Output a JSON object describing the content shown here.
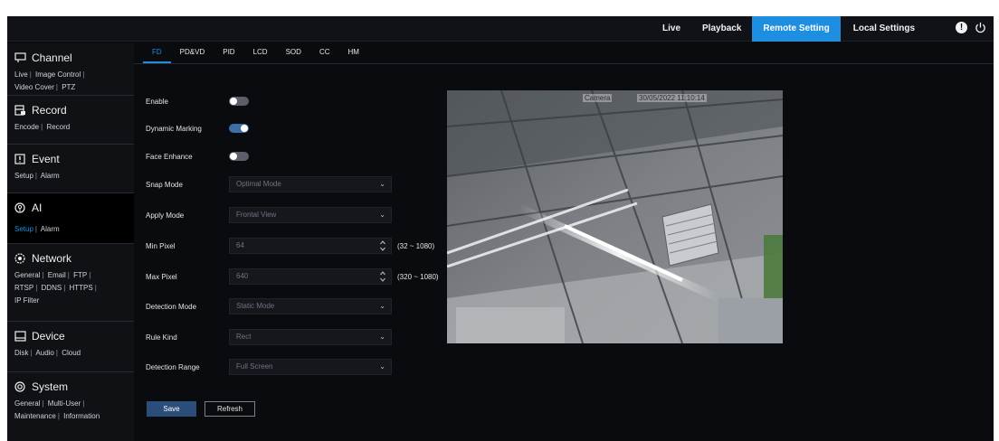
{
  "topnav": {
    "items": [
      {
        "label": "Live",
        "active": false
      },
      {
        "label": "Playback",
        "active": false
      },
      {
        "label": "Remote Setting",
        "active": true
      },
      {
        "label": "Local Settings",
        "active": false
      }
    ],
    "accent_color": "#1e8fe0"
  },
  "sidebar": {
    "sections": [
      {
        "title": "Channel",
        "icon": "channel-icon",
        "active": false,
        "links": [
          "Live",
          "Image Control",
          "Video Cover",
          "PTZ"
        ]
      },
      {
        "title": "Record",
        "icon": "record-icon",
        "active": false,
        "links": [
          "Encode",
          "Record"
        ]
      },
      {
        "title": "Event",
        "icon": "event-icon",
        "active": false,
        "links": [
          "Setup",
          "Alarm"
        ]
      },
      {
        "title": "AI",
        "icon": "ai-icon",
        "active": true,
        "links": [
          "Setup",
          "Alarm"
        ],
        "active_link": "Setup"
      },
      {
        "title": "Network",
        "icon": "network-icon",
        "active": false,
        "links": [
          "General",
          "Email",
          "FTP",
          "RTSP",
          "DDNS",
          "HTTPS",
          "IP Filter"
        ]
      },
      {
        "title": "Device",
        "icon": "device-icon",
        "active": false,
        "links": [
          "Disk",
          "Audio",
          "Cloud"
        ]
      },
      {
        "title": "System",
        "icon": "system-icon",
        "active": false,
        "links": [
          "General",
          "Multi-User",
          "Maintenance",
          "Information"
        ]
      }
    ]
  },
  "tabs": [
    {
      "label": "FD",
      "active": true
    },
    {
      "label": "PD&VD",
      "active": false
    },
    {
      "label": "PID",
      "active": false
    },
    {
      "label": "LCD",
      "active": false
    },
    {
      "label": "SOD",
      "active": false
    },
    {
      "label": "CC",
      "active": false
    },
    {
      "label": "HM",
      "active": false
    }
  ],
  "form": {
    "enable": {
      "label": "Enable",
      "on": false
    },
    "dynamic_marking": {
      "label": "Dynamic Marking",
      "on": true
    },
    "face_enhance": {
      "label": "Face Enhance",
      "on": false
    },
    "snap_mode": {
      "label": "Snap Mode",
      "value": "Optimal Mode"
    },
    "apply_mode": {
      "label": "Apply Mode",
      "value": "Frontal View"
    },
    "min_pixel": {
      "label": "Min Pixel",
      "value": "64",
      "range": "(32 ~ 1080)"
    },
    "max_pixel": {
      "label": "Max Pixel",
      "value": "640",
      "range": "(320 ~ 1080)"
    },
    "detection_mode": {
      "label": "Detection Mode",
      "value": "Static Mode"
    },
    "rule_kind": {
      "label": "Rule Kind",
      "value": "Rect"
    },
    "detection_range": {
      "label": "Detection Range",
      "value": "Full Screen"
    }
  },
  "buttons": {
    "save": "Save",
    "refresh": "Refresh"
  },
  "preview": {
    "camera_label": "Camera",
    "timestamp": "30/05/2022 11:10:14"
  }
}
